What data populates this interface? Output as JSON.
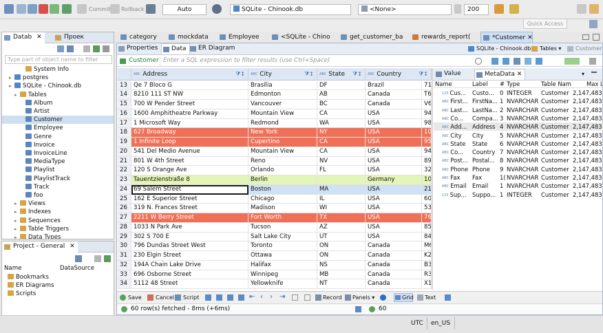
{
  "toolbar": {
    "commit": "Commit",
    "rollback": "Rollback",
    "tx_mode": "Auto",
    "datasource": "SQLite - Chinook.db",
    "schema": "<None>",
    "limit": "200",
    "quick_access": "Quick Access"
  },
  "left_top": {
    "tabs": [
      "Datab",
      "Проек"
    ],
    "filter_placeholder": "Type part of object name to filter",
    "tree": [
      {
        "label": "System Info",
        "level": 3,
        "icon": "folder"
      },
      {
        "label": "postgres",
        "level": 1,
        "icon": "db"
      },
      {
        "label": "SQLite - Chinook.db",
        "level": 1,
        "icon": "db"
      },
      {
        "label": "Tables",
        "level": 2,
        "icon": "folder"
      },
      {
        "label": "Album",
        "level": 3,
        "icon": "table"
      },
      {
        "label": "Artist",
        "level": 3,
        "icon": "table"
      },
      {
        "label": "Customer",
        "level": 3,
        "icon": "table",
        "selected": true
      },
      {
        "label": "Employee",
        "level": 3,
        "icon": "table"
      },
      {
        "label": "Genre",
        "level": 3,
        "icon": "table"
      },
      {
        "label": "Invoice",
        "level": 3,
        "icon": "table"
      },
      {
        "label": "InvoiceLine",
        "level": 3,
        "icon": "table"
      },
      {
        "label": "MediaType",
        "level": 3,
        "icon": "table"
      },
      {
        "label": "Playlist",
        "level": 3,
        "icon": "table"
      },
      {
        "label": "PlaylistTrack",
        "level": 3,
        "icon": "table"
      },
      {
        "label": "Track",
        "level": 3,
        "icon": "table"
      },
      {
        "label": "foo",
        "level": 3,
        "icon": "table"
      },
      {
        "label": "Views",
        "level": 2,
        "icon": "folder"
      },
      {
        "label": "Indexes",
        "level": 2,
        "icon": "folder"
      },
      {
        "label": "Sequences",
        "level": 2,
        "icon": "folder"
      },
      {
        "label": "Table Triggers",
        "level": 2,
        "icon": "folder"
      },
      {
        "label": "Data Types",
        "level": 2,
        "icon": "folder"
      }
    ]
  },
  "left_bottom": {
    "tab": "Project - General",
    "col_name": "Name",
    "col_datasource": "DataSource",
    "items": [
      "Bookmarks",
      "ER Diagrams",
      "Scripts"
    ]
  },
  "editor_tabs": [
    "category",
    "mockdata",
    "Employee",
    "<SQLite - Chino",
    "get_customer_ba",
    "rewards_report(",
    "*Customer"
  ],
  "sub_tabs": [
    "Properties",
    "Data",
    "ER Diagram"
  ],
  "sub_right": {
    "datasource": "SQLite - Chinook.db",
    "tables": "Tables",
    "customer": "Customer"
  },
  "filter": {
    "label": "Customer",
    "placeholder": "Enter a SQL expression to filter results (use Ctrl+Space)"
  },
  "grid": {
    "columns": [
      "Address",
      "City",
      "State",
      "Country"
    ],
    "col_prefix": "ABC",
    "rows": [
      {
        "n": "13",
        "address": "Qe 7 Bloco G",
        "city": "Brasília",
        "state": "DF",
        "country": "Brazil",
        "extra": "71",
        "hl": "none"
      },
      {
        "n": "14",
        "address": "8210 111 ST NW",
        "city": "Edmonton",
        "state": "AB",
        "country": "Canada",
        "extra": "T6",
        "hl": "none"
      },
      {
        "n": "15",
        "address": "700 W Pender Street",
        "city": "Vancouver",
        "state": "BC",
        "country": "Canada",
        "extra": "V6",
        "hl": "none"
      },
      {
        "n": "16",
        "address": "1600 Amphitheatre Parkway",
        "city": "Mountain View",
        "state": "CA",
        "country": "USA",
        "extra": "94",
        "hl": "none"
      },
      {
        "n": "17",
        "address": "1 Microsoft Way",
        "city": "Redmond",
        "state": "WA",
        "country": "USA",
        "extra": "98",
        "hl": "none"
      },
      {
        "n": "18",
        "address": "627 Broadway",
        "city": "New York",
        "state": "NY",
        "country": "USA",
        "extra": "10",
        "hl": "red"
      },
      {
        "n": "19",
        "address": "1 Infinite Loop",
        "city": "Cupertino",
        "state": "CA",
        "country": "USA",
        "extra": "95",
        "hl": "red"
      },
      {
        "n": "20",
        "address": "541 Del Medio Avenue",
        "city": "Mountain View",
        "state": "CA",
        "country": "USA",
        "extra": "94",
        "hl": "none"
      },
      {
        "n": "21",
        "address": "801 W 4th Street",
        "city": "Reno",
        "state": "NV",
        "country": "USA",
        "extra": "89",
        "hl": "none"
      },
      {
        "n": "22",
        "address": "120 S Orange Ave",
        "city": "Orlando",
        "state": "FL",
        "country": "USA",
        "extra": "32",
        "hl": "none"
      },
      {
        "n": "23",
        "address": "Tauentzienstraße 8",
        "city": "Berlin",
        "state": "",
        "country": "Germany",
        "extra": "10",
        "hl": "green"
      },
      {
        "n": "24",
        "address": "69 Salem Street",
        "city": "Boston",
        "state": "MA",
        "country": "USA",
        "extra": "21",
        "hl": "blue"
      },
      {
        "n": "25",
        "address": "162 E Superior Street",
        "city": "Chicago",
        "state": "IL",
        "country": "USA",
        "extra": "60",
        "hl": "none"
      },
      {
        "n": "26",
        "address": "319 N. Frances Street",
        "city": "Madison",
        "state": "WI",
        "country": "USA",
        "extra": "53",
        "hl": "none"
      },
      {
        "n": "27",
        "address": "2211 W Berry Street",
        "city": "Fort Worth",
        "state": "TX",
        "country": "USA",
        "extra": "76",
        "hl": "red"
      },
      {
        "n": "28",
        "address": "1033 N Park Ave",
        "city": "Tucson",
        "state": "AZ",
        "country": "USA",
        "extra": "85",
        "hl": "none"
      },
      {
        "n": "29",
        "address": "302 S 700 E",
        "city": "Salt Lake City",
        "state": "UT",
        "country": "USA",
        "extra": "84",
        "hl": "none"
      },
      {
        "n": "30",
        "address": "796 Dundas Street West",
        "city": "Toronto",
        "state": "ON",
        "country": "Canada",
        "extra": "M6",
        "hl": "none"
      },
      {
        "n": "31",
        "address": "230 Elgin Street",
        "city": "Ottawa",
        "state": "ON",
        "country": "Canada",
        "extra": "K2",
        "hl": "none"
      },
      {
        "n": "32",
        "address": "194A Chain Lake Drive",
        "city": "Halifax",
        "state": "NS",
        "country": "Canada",
        "extra": "B3",
        "hl": "none"
      },
      {
        "n": "33",
        "address": "696 Osborne Street",
        "city": "Winnipeg",
        "state": "MB",
        "country": "Canada",
        "extra": "R3",
        "hl": "none"
      },
      {
        "n": "34",
        "address": "5112 48 Street",
        "city": "Yellowknife",
        "state": "NT",
        "country": "Canada",
        "extra": "X1",
        "hl": "none"
      }
    ]
  },
  "right_panel": {
    "tabs": [
      "Value",
      "MetaData"
    ],
    "headers": [
      "Name",
      "Label",
      "#",
      "Type",
      "Table Name",
      "Max L"
    ],
    "rows": [
      {
        "name": "Cus...",
        "label": "Custo...",
        "num": "0",
        "type": "INTEGER",
        "table": "Customer",
        "max": "2,147,483"
      },
      {
        "name": "First...",
        "label": "FirstNa...",
        "num": "1",
        "type": "NVARCHAR",
        "table": "Customer",
        "max": "2,147,483"
      },
      {
        "name": "Last...",
        "label": "LastNa...",
        "num": "2",
        "type": "NVARCHAR",
        "table": "Customer",
        "max": "2,147,483"
      },
      {
        "name": "Co...",
        "label": "Compa...",
        "num": "3",
        "type": "NVARCHAR",
        "table": "Customer",
        "max": "2,147,483"
      },
      {
        "name": "Add...",
        "label": "Address",
        "num": "4",
        "type": "NVARCHAR",
        "table": "Customer",
        "max": "2,147,483"
      },
      {
        "name": "City",
        "label": "City",
        "num": "5",
        "type": "NVARCHAR",
        "table": "Customer",
        "max": "2,147,483"
      },
      {
        "name": "State",
        "label": "State",
        "num": "6",
        "type": "NVARCHAR",
        "table": "Customer",
        "max": "2,147,483"
      },
      {
        "name": "Co...",
        "label": "Country",
        "num": "7",
        "type": "NVARCHAR",
        "table": "Customer",
        "max": "2,147,483"
      },
      {
        "name": "Post...",
        "label": "Postal...",
        "num": "8",
        "type": "NVARCHAR",
        "table": "Customer",
        "max": "2,147,483"
      },
      {
        "name": "Phone",
        "label": "Phone",
        "num": "9",
        "type": "NVARCHAR",
        "table": "Customer",
        "max": "2,147,483"
      },
      {
        "name": "Fax",
        "label": "Fax",
        "num": "1(",
        "type": "NVARCHAR",
        "table": "Customer",
        "max": "2,147,483"
      },
      {
        "name": "Email",
        "label": "Email",
        "num": "1",
        "type": "NVARCHAR",
        "table": "Customer",
        "max": "2,147,483"
      },
      {
        "name": "Sup...",
        "label": "Suppo...",
        "num": "1",
        "type": "INTEGER",
        "table": "Customer",
        "max": "2,147,483"
      }
    ]
  },
  "bottom_toolbar": {
    "save": "Save",
    "cancel": "Cancel",
    "script": "Script",
    "record": "Record",
    "panels": "Panels",
    "grid": "Grid",
    "text": "Text"
  },
  "status": {
    "fetched": "60 row(s) fetched - 8ms (+6ms)",
    "count": "60",
    "tz": "UTC",
    "locale": "en_US"
  },
  "colors": {
    "highlight_red": "#f07057",
    "highlight_green": "#e4f5b8",
    "highlight_blue": "#cfe1f5",
    "header_bg": "#dde7f4",
    "accent": "#2b6cc4"
  }
}
